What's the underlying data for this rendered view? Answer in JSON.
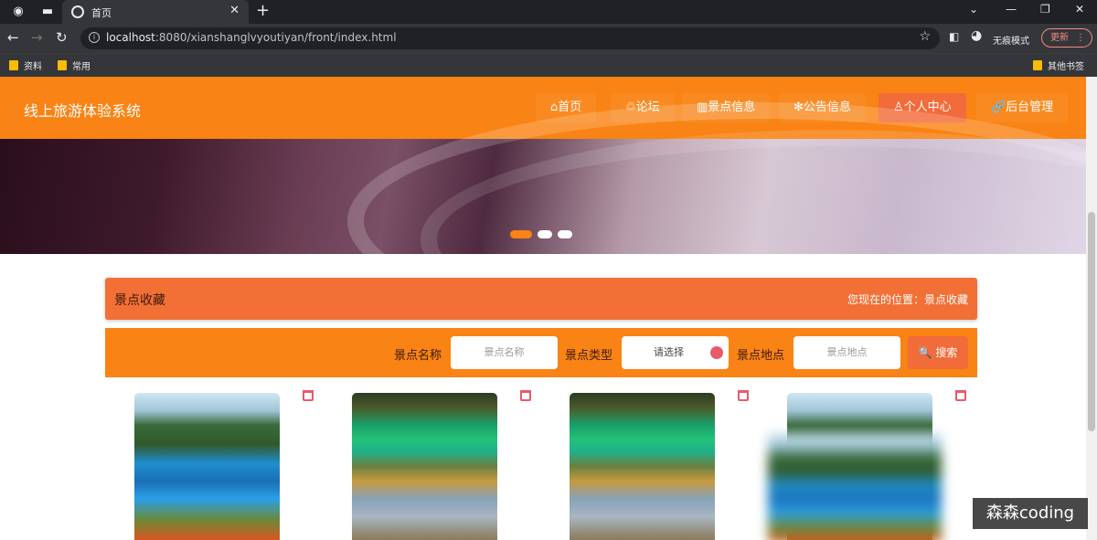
{
  "browser": {
    "tab_title": "首页",
    "url_host": "localhost",
    "url_rest": ":8080/xianshanglvyoutiyan/front/index.html",
    "incognito_label": "无痕模式",
    "update_label": "更新",
    "bookmarks": [
      "资料",
      "常用"
    ],
    "other_bookmarks": "其他书签"
  },
  "site": {
    "title": "线上旅游体验系统",
    "nav": [
      {
        "label": "⌂首页"
      },
      {
        "label": "♲论坛"
      },
      {
        "label": "▥景点信息"
      },
      {
        "label": "✻公告信息"
      },
      {
        "label": "♙个人中心"
      },
      {
        "label": "🔗后台管理"
      }
    ]
  },
  "banner": {
    "slides": 3,
    "active_slide": 1
  },
  "breadcrumb": {
    "title": "景点收藏",
    "location": "您现在的位置：景点收藏"
  },
  "search": {
    "name_label": "景点名称",
    "name_placeholder": "景点名称",
    "type_label": "景点类型",
    "type_value": "请选择",
    "place_label": "景点地点",
    "place_placeholder": "景点地点",
    "button_label": "🔍 搜索"
  },
  "cards": [
    {
      "image": "lake"
    },
    {
      "image": "pool"
    },
    {
      "image": "pool"
    },
    {
      "image": "lake"
    }
  ],
  "watermark": "森森coding"
}
